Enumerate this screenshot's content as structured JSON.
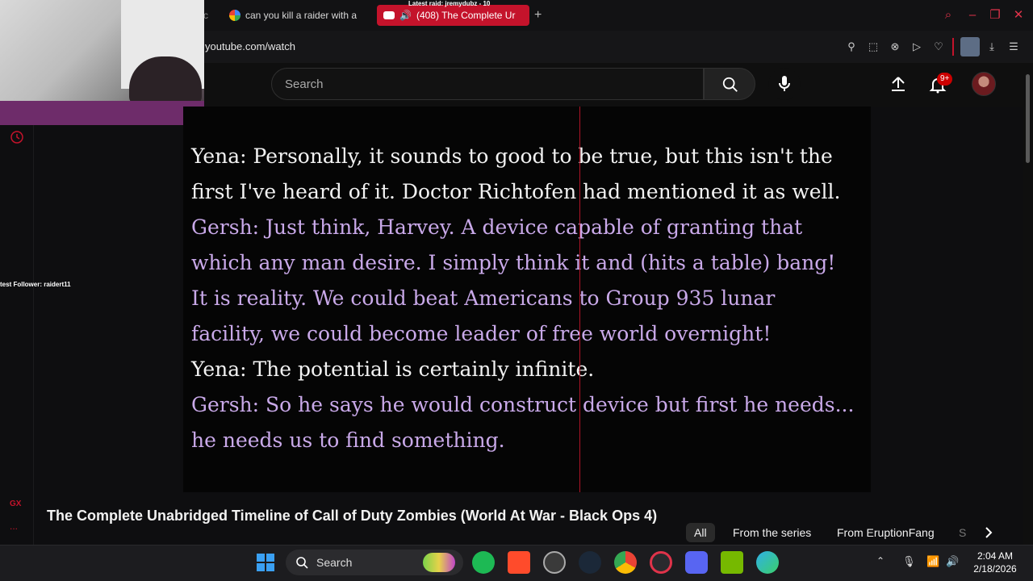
{
  "browser": {
    "raid_text": "Latest raid: jremydubz - 10",
    "tabs": [
      {
        "label": "c",
        "active": false
      },
      {
        "label": "can you kill a raider with a",
        "active": false
      },
      {
        "label": "(408) The Complete Ur",
        "active": true
      }
    ],
    "new_tab_symbol": "+",
    "url": "youtube.com/watch",
    "accent": "#c4132b"
  },
  "youtube": {
    "search_placeholder": "Search",
    "notification_badge": "9+"
  },
  "overlay": {
    "follower_text": "test Follower: raidert11"
  },
  "subtitles": [
    {
      "speaker": "yena",
      "text": "Yena: Personally, it sounds to good to be true, but this isn't the"
    },
    {
      "speaker": "yena",
      "text": "first I've heard of it. Doctor Richtofen had mentioned it as well."
    },
    {
      "speaker": "gersh",
      "text": "Gersh: Just think, Harvey. A device capable of granting that"
    },
    {
      "speaker": "gersh",
      "text": "which any man desire. I simply think it and (hits a table) bang!"
    },
    {
      "speaker": "gersh",
      "text": "It is reality. We could beat Americans to Group 935 lunar"
    },
    {
      "speaker": "gersh",
      "text": "facility, we could become leader of free world overnight!"
    },
    {
      "speaker": "yena",
      "text": "Yena: The potential is certainly infinite."
    },
    {
      "speaker": "gersh",
      "text": "Gersh: So he says he would construct device but first he needs..."
    },
    {
      "speaker": "gersh",
      "text": "he needs us to find something."
    }
  ],
  "video": {
    "title": "The Complete Unabridged Timeline of Call of Duty Zombies (World At War - Black Ops 4)"
  },
  "chips": [
    {
      "label": "All"
    },
    {
      "label": "From the series"
    },
    {
      "label": "From EruptionFang"
    },
    {
      "label": "S"
    }
  ],
  "sidebar": {
    "gx_label": "GX",
    "more_label": "..."
  },
  "taskbar": {
    "search_label": "Search",
    "time": "2:04 AM",
    "date": "2/18/2026"
  }
}
